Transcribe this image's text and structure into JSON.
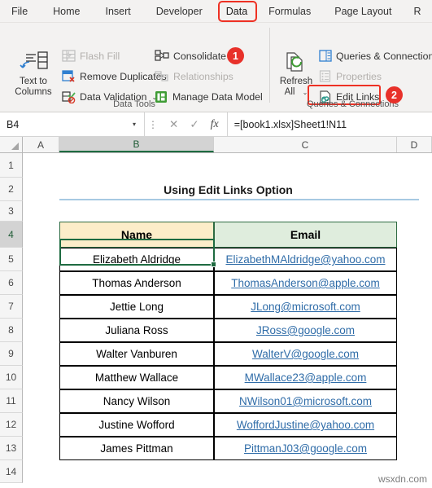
{
  "ribbon": {
    "tabs": [
      {
        "label": "File",
        "highlighted": false
      },
      {
        "label": "Home",
        "highlighted": false
      },
      {
        "label": "Insert",
        "highlighted": false
      },
      {
        "label": "Developer",
        "highlighted": false
      },
      {
        "label": "Data",
        "highlighted": true
      },
      {
        "label": "Formulas",
        "highlighted": false
      },
      {
        "label": "Page Layout",
        "highlighted": false
      },
      {
        "label": "R",
        "highlighted": false
      }
    ],
    "groups": [
      {
        "name": "data-tools",
        "label": "Data Tools"
      },
      {
        "name": "queries-connections",
        "label": "Queries & Connections"
      }
    ],
    "data_tools": {
      "text_to_columns": {
        "line1": "Text to",
        "line2": "Columns",
        "icon": "text-to-columns-icon",
        "disabled": false
      },
      "flash_fill": {
        "label": "Flash Fill",
        "icon": "flash-fill-icon",
        "disabled": true
      },
      "remove_duplicates": {
        "label": "Remove Duplicates",
        "icon": "remove-duplicates-icon",
        "disabled": false
      },
      "data_validation": {
        "label": "Data Validation",
        "icon": "data-validation-icon",
        "disabled": false,
        "caret": "⌄"
      },
      "consolidate": {
        "label": "Consolidate",
        "icon": "consolidate-icon",
        "disabled": false
      },
      "relationships": {
        "label": "Relationships",
        "icon": "relationships-icon",
        "disabled": true
      },
      "manage_data_model": {
        "label": "Manage Data Model",
        "icon": "manage-data-model-icon",
        "disabled": false
      }
    },
    "queries": {
      "refresh_all": {
        "line1": "Refresh",
        "line2": "All",
        "icon": "refresh-all-icon",
        "caret": "⌄",
        "disabled": false
      },
      "queries_connections": {
        "label": "Queries & Connections",
        "icon": "queries-connections-icon",
        "disabled": false
      },
      "properties": {
        "label": "Properties",
        "icon": "properties-icon",
        "disabled": true
      },
      "edit_links": {
        "label": "Edit Links",
        "icon": "edit-links-icon",
        "disabled": false,
        "highlighted": true
      }
    },
    "callouts": [
      {
        "number": "1",
        "target": "consolidate"
      },
      {
        "number": "2",
        "target": "edit-links"
      }
    ],
    "accent_color": "#ee3124"
  },
  "formula_bar": {
    "name_box_value": "B4",
    "cancel_icon": "✕",
    "confirm_icon": "✓",
    "function_icon": "fx",
    "formula": "=[book1.xlsx]Sheet1!N11",
    "dropdown_caret": "▾"
  },
  "sheet": {
    "column_headers": [
      "A",
      "B",
      "C",
      "D"
    ],
    "selected_column": "B",
    "row_headers": [
      "1",
      "2",
      "3",
      "4",
      "5",
      "6",
      "7",
      "8",
      "9",
      "10",
      "11",
      "12",
      "13",
      "14"
    ],
    "selected_row": "4",
    "active_cell": "B4",
    "title": "Using Edit Links Option",
    "table": {
      "headers": [
        "Name",
        "Email"
      ],
      "header_fills": [
        "#fcedc9",
        "#dfeddd"
      ],
      "rows": [
        {
          "name": "Elizabeth Aldridge",
          "email": "ElizabethMAldridge@yahoo.com"
        },
        {
          "name": "Thomas Anderson",
          "email": "ThomasAnderson@apple.com"
        },
        {
          "name": "Jettie Long",
          "email": "JLong@microsoft.com"
        },
        {
          "name": "Juliana Ross",
          "email": "JRoss@google.com"
        },
        {
          "name": "Walter Vanburen",
          "email": "WalterV@google.com"
        },
        {
          "name": "Matthew Wallace",
          "email": "MWallace23@apple.com"
        },
        {
          "name": "Nancy Wilson",
          "email": "NWilson01@microsoft.com"
        },
        {
          "name": "Justine Wofford",
          "email": "WoffordJustine@yahoo.com"
        },
        {
          "name": "James Pittman",
          "email": "PittmanJ03@google.com"
        }
      ],
      "link_color": "#2f6ca8"
    }
  },
  "watermark": "wsxdn.com"
}
